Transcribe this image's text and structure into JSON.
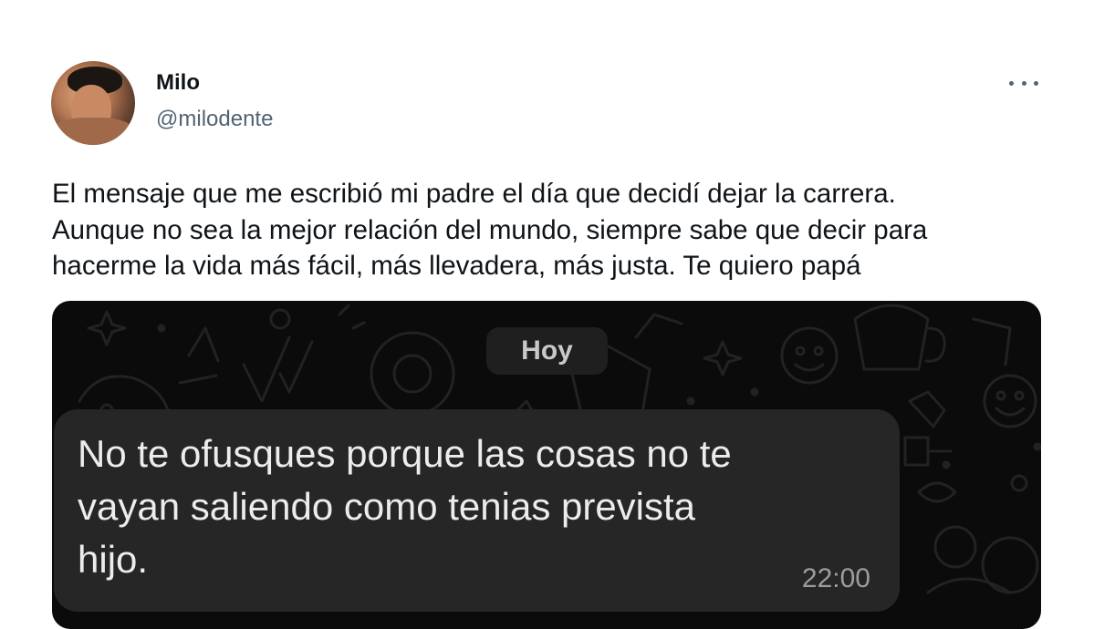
{
  "author": {
    "name": "Milo",
    "handle": "@milodente",
    "avatar_icon": "profile-photo"
  },
  "menu": {
    "icon": "more-horizontal-icon"
  },
  "tweet": {
    "text": "El mensaje que me escribió mi padre el día que decidí dejar la carrera.\nAunque no sea la mejor relación del mundo, siempre sabe que decir para\nhacerme la vida más fácil, más llevadera, más justa. Te quiero papá"
  },
  "chat": {
    "date_label": "Hoy",
    "message": {
      "text": "No te ofusques porque las cosas no te\nvayan saliendo como tenias prevista\nhijo.",
      "time": "22:00"
    }
  },
  "colors": {
    "text": "#0f1419",
    "secondary": "#536471",
    "chat_background": "#0b0b0b",
    "bubble": "#262626"
  }
}
